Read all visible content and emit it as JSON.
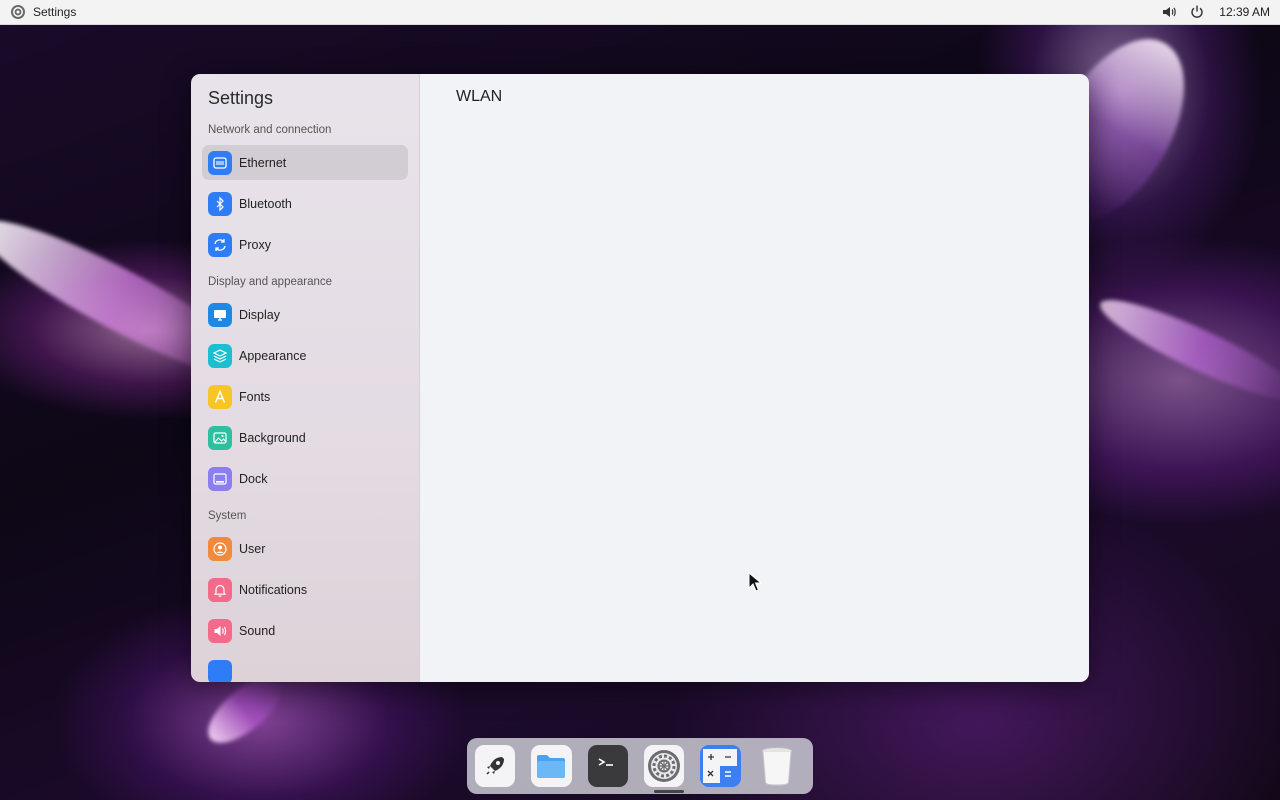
{
  "topbar": {
    "app_name": "Settings",
    "clock": "12:39 AM",
    "tray_icons": [
      "volume-icon",
      "power-icon"
    ]
  },
  "window": {
    "sidebar_title": "Settings",
    "content_title": "WLAN",
    "sections": [
      {
        "label": "Network and connection",
        "items": [
          {
            "label": "Ethernet",
            "icon": "ethernet-icon",
            "color": "#2f7df6",
            "active": true
          },
          {
            "label": "Bluetooth",
            "icon": "bluetooth-icon",
            "color": "#2f7df6"
          },
          {
            "label": "Proxy",
            "icon": "proxy-icon",
            "color": "#2f7df6"
          }
        ]
      },
      {
        "label": "Display and appearance",
        "items": [
          {
            "label": "Display",
            "icon": "display-icon",
            "color": "#1e88e5"
          },
          {
            "label": "Appearance",
            "icon": "appearance-icon",
            "color": "#1bbfd0"
          },
          {
            "label": "Fonts",
            "icon": "fonts-icon",
            "color": "#f7c624"
          },
          {
            "label": "Background",
            "icon": "background-icon",
            "color": "#2cbfa0"
          },
          {
            "label": "Dock",
            "icon": "dock-icon",
            "color": "#8a7ef0"
          }
        ]
      },
      {
        "label": "System",
        "items": [
          {
            "label": "User",
            "icon": "user-icon",
            "color": "#f08a3c"
          },
          {
            "label": "Notifications",
            "icon": "notifications-icon",
            "color": "#f46a8a"
          },
          {
            "label": "Sound",
            "icon": "sound-icon",
            "color": "#f46a8a"
          }
        ]
      }
    ]
  },
  "dock": {
    "apps": [
      "launcher-icon",
      "files-icon",
      "terminal-icon",
      "settings-icon",
      "calculator-icon",
      "trash-icon"
    ]
  }
}
